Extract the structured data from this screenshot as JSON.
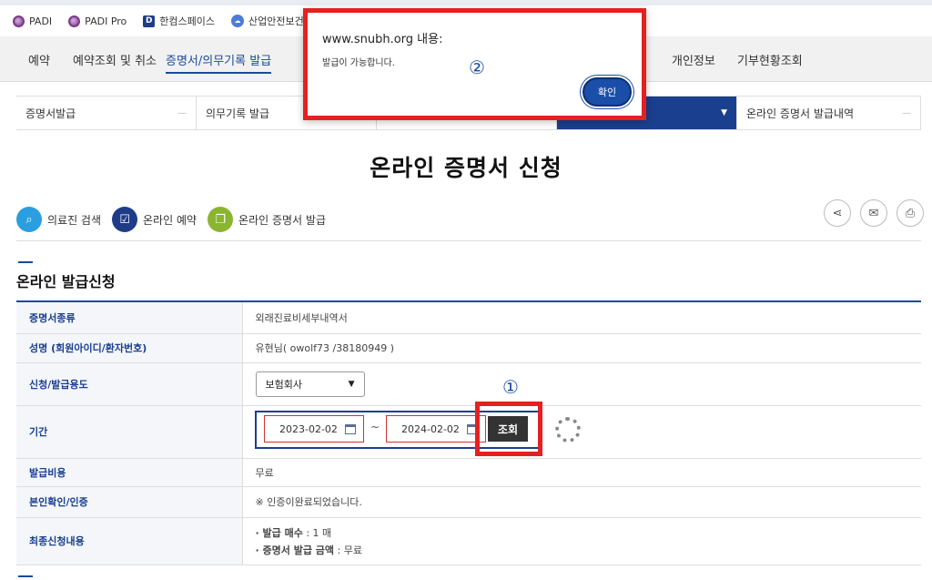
{
  "bookmarks": [
    {
      "icon": "globe-icon",
      "label": "PADI"
    },
    {
      "icon": "globe-icon",
      "label": "PADI Pro"
    },
    {
      "icon": "d-logo-icon",
      "label": "한컴스페이스"
    },
    {
      "icon": "cloud-icon",
      "label": "산업안전보건교육"
    }
  ],
  "gnb": {
    "items": [
      "예약",
      "예약조회 및 취소",
      "증명서/의무기록 발급",
      "개인정보",
      "기부현황조회"
    ]
  },
  "subnav": {
    "items": [
      "증명서발급",
      "의무기록 발급",
      "",
      "온라인 증명서 발급내역"
    ]
  },
  "page_title": "온라인 증명서 신청",
  "shortcuts": [
    {
      "label": "의료진 검색",
      "color": "#2a9ee0"
    },
    {
      "label": "온라인 예약",
      "color": "#1f3c88"
    },
    {
      "label": "온라인 증명서 발급",
      "color": "#8ab530"
    }
  ],
  "section_title": "온라인 발급신청",
  "form": {
    "cert_type_label": "증명서종류",
    "cert_type_value": "외래진료비세부내역서",
    "name_label": "성명 (회원아이디/환자번호)",
    "name_value": "유현님( owolf73 /38180949 )",
    "purpose_label": "신청/발급용도",
    "purpose_value": "보험회사",
    "period_label": "기간",
    "date_from": "2023-02-02",
    "date_sep": "~",
    "date_to": "2024-02-02",
    "search_button": "조회",
    "fee_label": "발급비용",
    "fee_value": "무료",
    "auth_label": "본인확인/인증",
    "auth_value": "※ 인증이완료되었습니다.",
    "summary_label": "최종신청내용",
    "summary_line1_key": "· 발급 매수",
    "summary_line1_val": " : 1 매",
    "summary_line2_key": "· 증명서 발급 금액",
    "summary_line2_val": " : 무료"
  },
  "dialog": {
    "title": "www.snubh.org 내용:",
    "message": "발급이 가능합니다.",
    "ok_button": "확인"
  },
  "markers": {
    "one": "①",
    "two": "②"
  }
}
